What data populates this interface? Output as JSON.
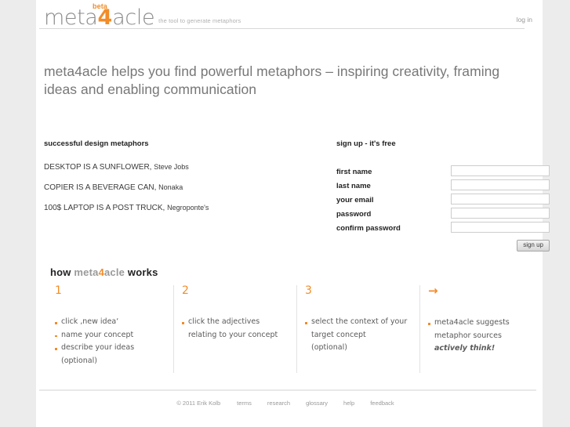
{
  "header": {
    "logo": {
      "part1": "meta",
      "four": "4",
      "part2": "acle",
      "beta": "beta",
      "tagline": "the tool to generate metaphors"
    },
    "login_label": "log in"
  },
  "headline": "meta4acle helps you find powerful metaphors – inspiring creativity, framing ideas and enabling communication",
  "metaphors": {
    "title": "successful design metaphors",
    "items": [
      {
        "phrase": "DESKTOP IS A SUNFLOWER,",
        "author": "Steve Jobs"
      },
      {
        "phrase": "COPIER IS A BEVERAGE CAN,",
        "author": "Nonaka"
      },
      {
        "phrase": "100$ LAPTOP IS A POST TRUCK,",
        "author": "Negroponte's"
      }
    ]
  },
  "signup": {
    "title": "sign up - it's free",
    "fields": [
      {
        "label": "first name",
        "value": "",
        "placeholder": ""
      },
      {
        "label": "last name",
        "value": "",
        "placeholder": ""
      },
      {
        "label": "your email",
        "value": "",
        "placeholder": ""
      },
      {
        "label": "password",
        "value": "",
        "placeholder": ""
      },
      {
        "label": "confirm password",
        "value": "",
        "placeholder": ""
      }
    ],
    "button_label": "sign up"
  },
  "how_it_works": {
    "title_prefix": "how ",
    "title_brand_1": "meta",
    "title_brand_4": "4",
    "title_brand_2": "acle",
    "title_suffix": " works",
    "steps": [
      {
        "marker": "1",
        "marker_type": "number",
        "lines": [
          {
            "text": "click ‚new idea‘",
            "bullet": true,
            "accent": false
          },
          {
            "text": "name your concept",
            "bullet": true,
            "accent": false
          },
          {
            "text": "describe your ideas",
            "bullet": true,
            "accent": false
          },
          {
            "text": "(optional)",
            "bullet": false,
            "accent": false
          }
        ]
      },
      {
        "marker": "2",
        "marker_type": "number",
        "lines": [
          {
            "text": "click the adjectives",
            "bullet": true,
            "accent": false
          },
          {
            "text": "relating to your concept",
            "bullet": false,
            "accent": false
          }
        ]
      },
      {
        "marker": "3",
        "marker_type": "number",
        "lines": [
          {
            "text": "select the context of your",
            "bullet": true,
            "accent": false
          },
          {
            "text": "target concept",
            "bullet": false,
            "accent": false
          },
          {
            "text": "(optional)",
            "bullet": false,
            "accent": false
          }
        ]
      },
      {
        "marker": "→",
        "marker_type": "arrow",
        "lines": [
          {
            "text": "meta4acle suggests",
            "bullet": true,
            "accent": false
          },
          {
            "text": "metaphor sources",
            "bullet": false,
            "accent": false
          },
          {
            "text": "actively think!",
            "bullet": false,
            "accent": true
          }
        ]
      }
    ]
  },
  "footer": {
    "copyright": "© 2011 Erik Kolb",
    "links": [
      "terms",
      "research",
      "glossary",
      "help",
      "feedback"
    ]
  },
  "colors": {
    "accent": "#f28c28",
    "text": "#5a5a5a",
    "muted": "#9a9a9a",
    "page_bg": "#ececec",
    "card_bg": "#ffffff"
  }
}
